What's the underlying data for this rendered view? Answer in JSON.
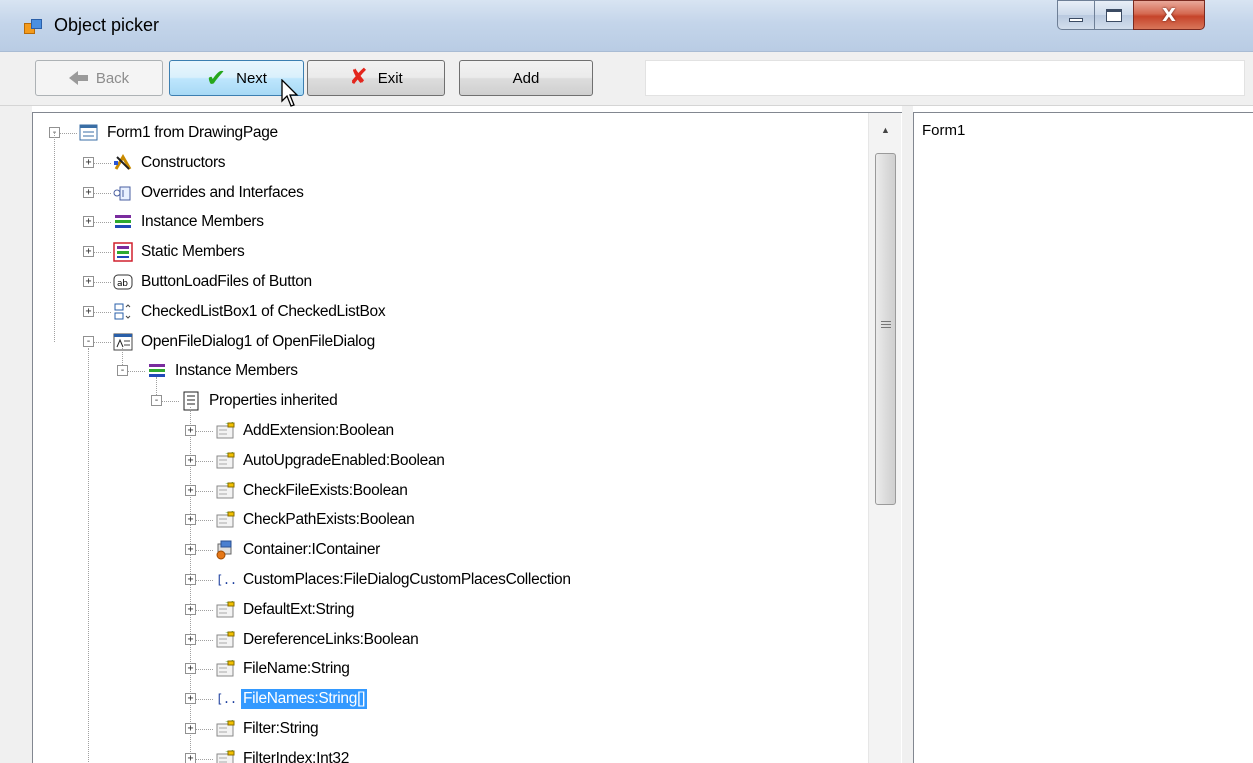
{
  "window": {
    "title": "Object picker",
    "close_label": "X"
  },
  "toolbar": {
    "back_label": "Back",
    "next_label": "Next",
    "exit_label": "Exit",
    "add_label": "Add",
    "path_value": ""
  },
  "tree": {
    "root": "Form1 from DrawingPage",
    "items": [
      {
        "label": "Constructors",
        "icon": "constructors-icon"
      },
      {
        "label": "Overrides and Interfaces",
        "icon": "interfaces-icon"
      },
      {
        "label": "Instance Members",
        "icon": "members-icon"
      },
      {
        "label": "Static Members",
        "icon": "static-members-icon"
      },
      {
        "label": "ButtonLoadFiles of Button",
        "icon": "button-control-icon"
      },
      {
        "label": "CheckedListBox1 of CheckedListBox",
        "icon": "checkedlistbox-icon"
      },
      {
        "label": "OpenFileDialog1 of OpenFileDialog",
        "icon": "openfiledialog-icon"
      }
    ],
    "instance_members": "Instance Members",
    "properties_inherited": "Properties inherited",
    "properties": [
      {
        "label": "AddExtension:Boolean",
        "icon": "property-icon"
      },
      {
        "label": "AutoUpgradeEnabled:Boolean",
        "icon": "property-icon"
      },
      {
        "label": "CheckFileExists:Boolean",
        "icon": "property-icon"
      },
      {
        "label": "CheckPathExists:Boolean",
        "icon": "property-icon"
      },
      {
        "label": "Container:IContainer",
        "icon": "container-icon"
      },
      {
        "label": "CustomPlaces:FileDialogCustomPlacesCollection",
        "icon": "array-icon"
      },
      {
        "label": "DefaultExt:String",
        "icon": "property-icon"
      },
      {
        "label": "DereferenceLinks:Boolean",
        "icon": "property-icon"
      },
      {
        "label": "FileName:String",
        "icon": "property-icon"
      },
      {
        "label": "FileNames:String[]",
        "icon": "array-icon"
      },
      {
        "label": "Filter:String",
        "icon": "property-icon"
      },
      {
        "label": "FilterIndex:Int32",
        "icon": "property-icon"
      }
    ],
    "selected": "FileNames:String[]"
  },
  "right_panel": {
    "text": "Form1"
  },
  "colors": {
    "selection": "#3399ff",
    "titlebar": "#c4d5ea",
    "close": "#c6442a"
  }
}
